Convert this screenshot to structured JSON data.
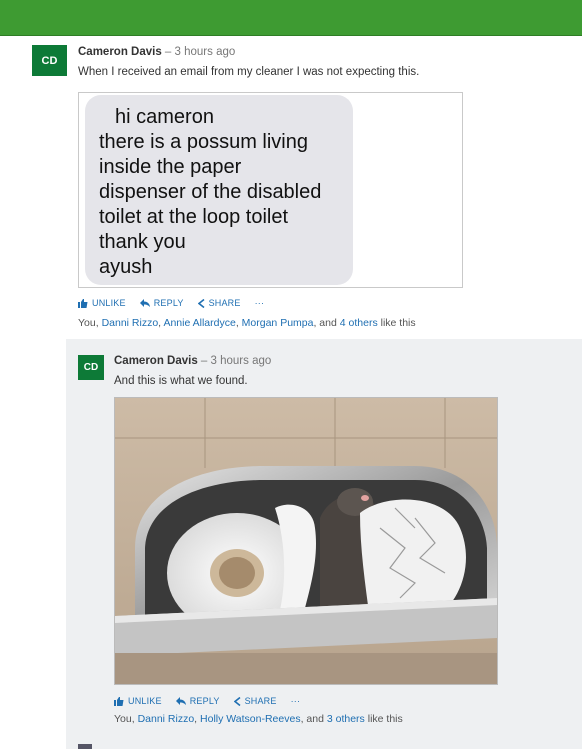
{
  "post": {
    "avatar_initials": "CD",
    "author": "Cameron Davis",
    "time": " – 3 hours ago",
    "text": "When I received an email from my cleaner I was not expecting this.",
    "image_message_lines": [
      "hi cameron",
      "there is a possum living",
      "inside the paper",
      "dispenser of the disabled",
      "toilet at the loop toilet",
      "thank you",
      "ayush"
    ],
    "actions": {
      "unlike": "UNLIKE",
      "reply": "REPLY",
      "share": "SHARE",
      "more": "···"
    },
    "likes": {
      "you": "You, ",
      "p1": "Danni Rizzo",
      "sep1": ", ",
      "p2": "Annie Allardyce",
      "sep2": ", ",
      "p3": "Morgan Pumpa",
      "and": ", and ",
      "others": "4 others",
      "suffix": " like this"
    }
  },
  "reply": {
    "avatar_initials": "CD",
    "author": "Cameron Davis",
    "time": " – 3 hours ago",
    "text": "And this is what we found.",
    "actions": {
      "unlike": "UNLIKE",
      "reply": "REPLY",
      "share": "SHARE",
      "more": "···"
    },
    "likes": {
      "you": "You, ",
      "p1": "Danni Rizzo",
      "sep1": ", ",
      "p2": "Holly Watson-Reeves",
      "and": ", and ",
      "others": "3 others",
      "suffix": " like this"
    }
  },
  "colors": {
    "topbar": "#3e9b32",
    "avatar": "#0d7a37",
    "link": "#1f6fb2",
    "reply_bg": "#eef0f2"
  }
}
